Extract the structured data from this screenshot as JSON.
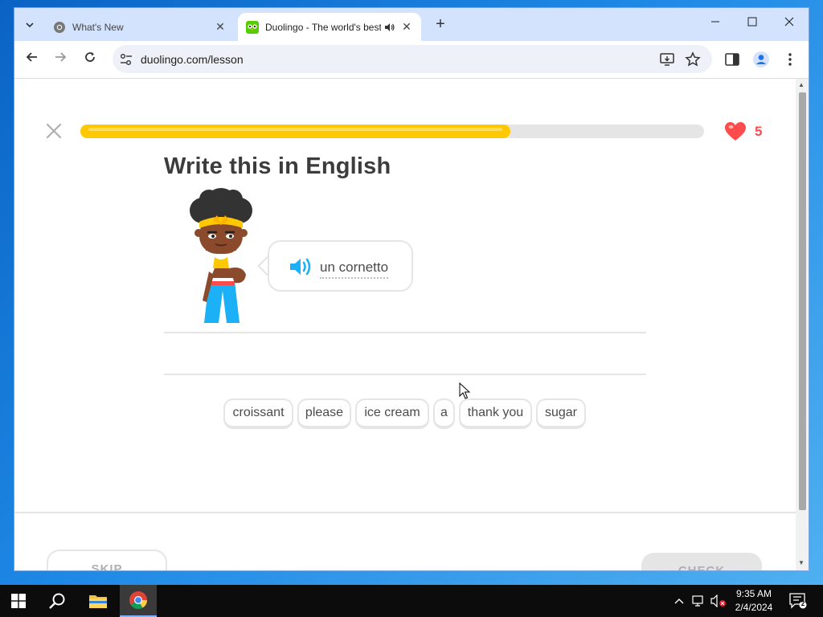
{
  "browser": {
    "tabs": [
      {
        "title": "What's New",
        "active": false
      },
      {
        "title": "Duolingo - The world's best",
        "active": true
      }
    ],
    "url": "duolingo.com/lesson"
  },
  "lesson": {
    "progress_fraction": 0.69,
    "hearts": "5",
    "heading": "Write this in English",
    "prompt_text": "un cornetto",
    "word_bank": [
      "croissant",
      "please",
      "ice cream",
      "a",
      "thank you",
      "sugar"
    ],
    "skip_label": "SKIP",
    "check_label": "CHECK"
  },
  "colors": {
    "progress": "#ffc800",
    "heart": "#ff4b4b",
    "speaker": "#1cb0f6",
    "text": "#3c3c3c"
  },
  "taskbar": {
    "time": "9:35 AM",
    "date": "2/4/2024",
    "notification_count": "2"
  }
}
